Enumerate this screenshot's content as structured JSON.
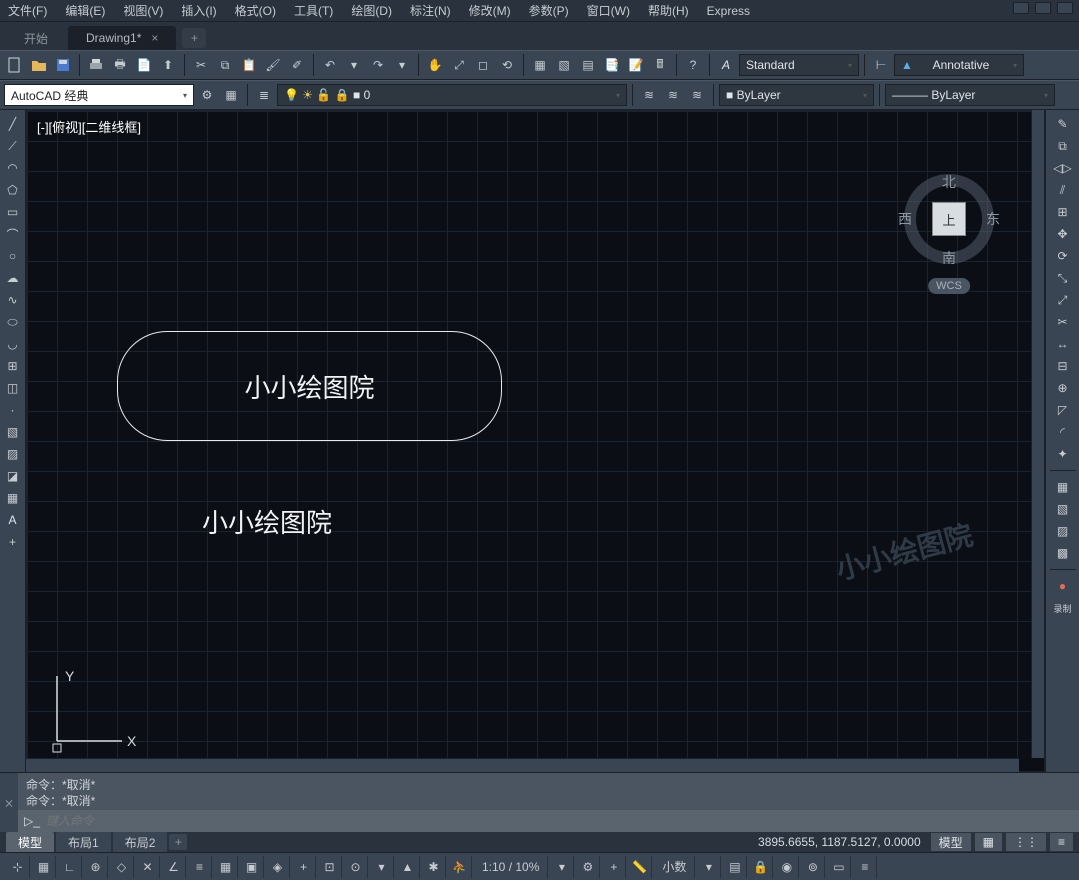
{
  "menu": {
    "items": [
      "文件(F)",
      "编辑(E)",
      "视图(V)",
      "插入(I)",
      "格式(O)",
      "工具(T)",
      "绘图(D)",
      "标注(N)",
      "修改(M)",
      "参数(P)",
      "窗口(W)",
      "帮助(H)",
      "Express"
    ]
  },
  "tabs": {
    "start": "开始",
    "active": "Drawing1*"
  },
  "toolbar": {
    "workspace_combo": "AutoCAD 经典",
    "layer_value": "0",
    "color_combo": "ByLayer",
    "linetype_combo": "ByLayer",
    "textstyle_combo": "Standard",
    "dimstyle_combo": "Annotative"
  },
  "viewport": {
    "label": "[-][俯视][二维线框]",
    "slot_text": "小小绘图院",
    "floating_text": "小小绘图院",
    "watermark": "小小绘图院",
    "ucs_x": "X",
    "ucs_y": "Y",
    "nav": {
      "n": "北",
      "s": "南",
      "e": "东",
      "w": "西",
      "top": "上",
      "wcs": "WCS"
    }
  },
  "command": {
    "hist1": "命令：*取消*",
    "hist2": "命令：*取消*",
    "placeholder": "键入命令"
  },
  "layout_tabs": [
    "模型",
    "布局1",
    "布局2"
  ],
  "status": {
    "coords": "3895.6655, 1187.5127, 0.0000",
    "model_btn": "模型",
    "scale": "1:10 / 10%",
    "units": "小数"
  },
  "rec_label": "录制"
}
